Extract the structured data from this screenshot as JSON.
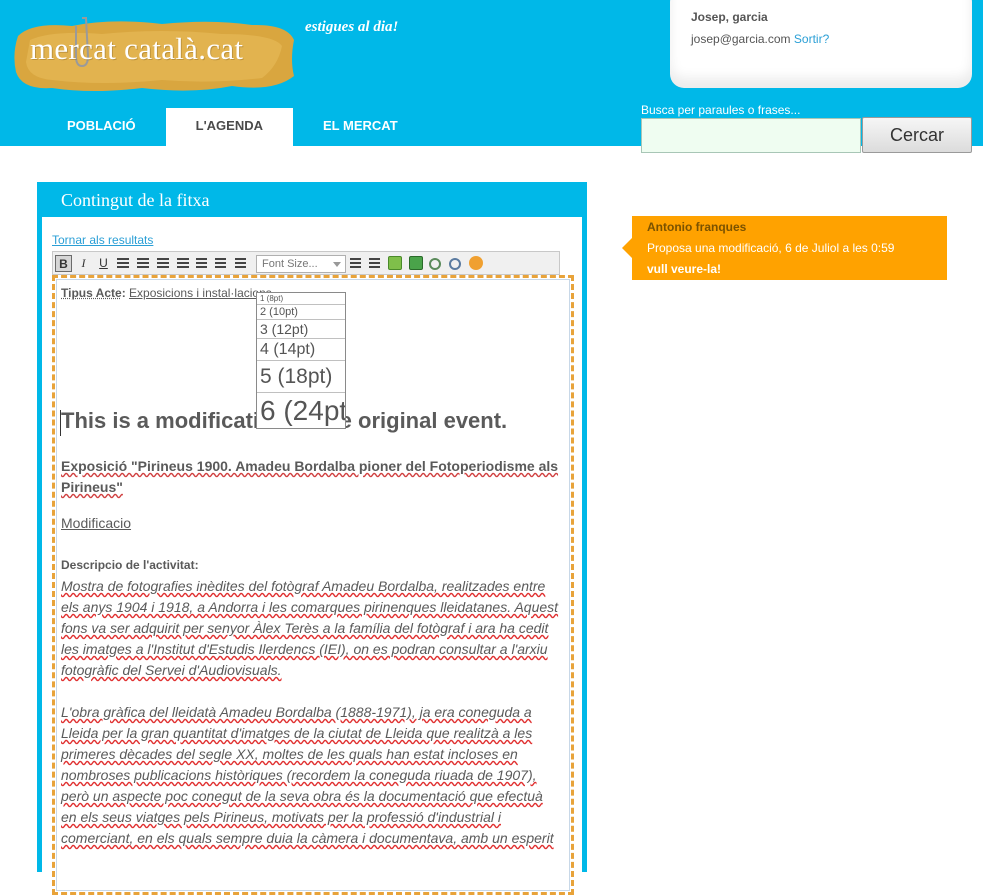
{
  "header": {
    "logo_text": "mercat català.cat",
    "tagline": "estigues al dia!",
    "user": {
      "name": "Josep, garcia",
      "email": "josep@garcia.com",
      "logout": "Sortir?"
    },
    "nav": [
      {
        "label": "POBLACIÓ",
        "active": false
      },
      {
        "label": "L'AGENDA",
        "active": true
      },
      {
        "label": "EL MERCAT",
        "active": false
      }
    ],
    "search": {
      "label": "Busca per paraules o frases...",
      "value": "",
      "button": "Cercar"
    }
  },
  "panel": {
    "title": "Contingut de la fitxa",
    "back_link": "Tornar als resultats",
    "toolbar": {
      "font_size_placeholder": "Font Size...",
      "font_size_options": [
        "1 (8pt)",
        "2 (10pt)",
        "3 (12pt)",
        "4 (14pt)",
        "5 (18pt)",
        "6 (24pt)"
      ]
    },
    "editor": {
      "type_label": "Tipus Acte",
      "type_value": "Exposicions i instal·lacions",
      "modification_heading": "This is a modification of the original event.",
      "exposicio": "Exposició \"Pirineus 1900. Amadeu Bordalba pioner del Fotoperiodisme als Pirineus\"",
      "modificacio": "Modificacio",
      "description_label": "Descripcio de l'activitat:",
      "description_paragraphs": [
        "Mostra de fotografies inèdites del fotògraf Amadeu Bordalba, realitzades entre els anys 1904 i 1918, a Andorra i les comarques pirinenques lleidatanes. Aquest fons va ser adquirit per senyor Àlex Terès a la família del fotògraf i ara ha cedit les imatges a l'Institut d'Estudis Ilerdencs (IEI), on es podran consultar a l'arxiu fotogràfic del Servei d'Audiovisuals.",
        "L'obra gràfica del lleidatà Amadeu Bordalba (1888-1971), ja era coneguda a Lleida per la gran quantitat d'imatges de la ciutat de Lleida que realitzà a les primeres dècades del segle XX, moltes de les quals han estat incloses en nombroses publicacions històriques (recordem la coneguda riuada de 1907), però un aspecte poc conegut de la seva obra és la documentació que efectuà en els seus viatges pels Pirineus, motivats per la professió d'industrial i comerciant, en els quals sempre duia la càmera i documentava, amb un esperit"
      ]
    }
  },
  "notice": {
    "name": "Antonio franques",
    "text": "Proposa una modificació, 6 de Juliol a les 0:59",
    "link": "vull veure-la!"
  },
  "colors": {
    "header_bg": "#00b8e8",
    "notice_bg": "#ffa200",
    "link": "#2a9fd6"
  }
}
